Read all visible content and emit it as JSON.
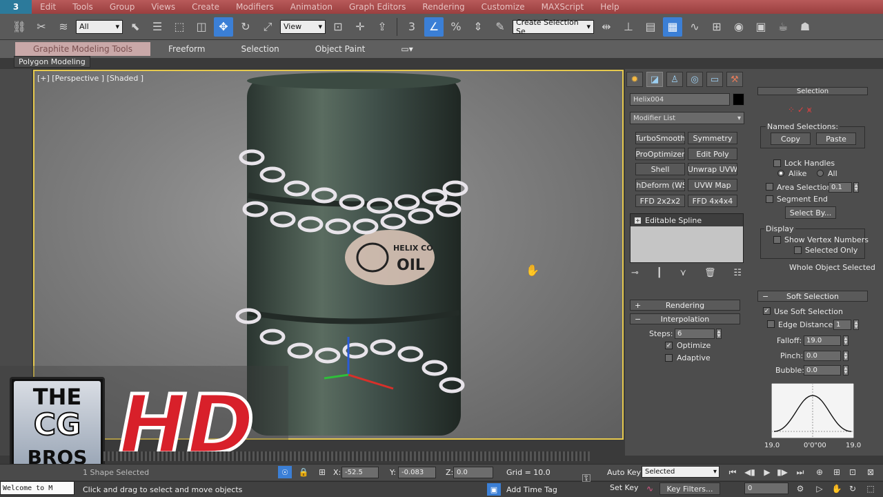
{
  "menu": {
    "logo": "3",
    "items": [
      "Edit",
      "Tools",
      "Group",
      "Views",
      "Create",
      "Modifiers",
      "Animation",
      "Graph Editors",
      "Rendering",
      "Customize",
      "MAXScript",
      "Help"
    ]
  },
  "toolbar": {
    "filter_value": "All",
    "view_value": "View",
    "snap_label": "3",
    "selection_set_value": "Create Selection Se"
  },
  "ribbon": {
    "tabs": [
      "Graphite Modeling Tools",
      "Freeform",
      "Selection",
      "Object Paint"
    ],
    "panel_label": "Polygon Modeling"
  },
  "viewport": {
    "label": "[+] [Perspective ] [Shaded ]",
    "barrel_text_top": "HELIX CO",
    "barrel_text_bottom": "OIL"
  },
  "watermark": {
    "line1": "THE",
    "line2": "CG",
    "line3": "BROS",
    "hd": "HD"
  },
  "command_panel": {
    "object_name": "Helix004",
    "modifier_list": "Modifier List",
    "modifier_buttons": [
      "TurboSmooth",
      "Symmetry",
      "ProOptimizer",
      "Edit Poly",
      "Shell",
      "Unwrap UVW",
      "thDeform (WS",
      "UVW Map",
      "FFD 2x2x2",
      "FFD 4x4x4"
    ],
    "stack_item": "Editable Spline",
    "rendering": "Rendering",
    "interpolation": "Interpolation",
    "steps_label": "Steps:",
    "steps_value": "6",
    "optimize": "Optimize",
    "adaptive": "Adaptive"
  },
  "selection_rollout": {
    "title": "Selection",
    "named_selections": "Named Selections:",
    "copy": "Copy",
    "paste": "Paste",
    "lock_handles": "Lock Handles",
    "alike": "Alike",
    "all": "All",
    "area_selection": "Area Selection:",
    "area_value": "0.1",
    "segment_end": "Segment End",
    "select_by": "Select By...",
    "display": "Display",
    "show_vertex_numbers": "Show Vertex Numbers",
    "selected_only": "Selected Only",
    "whole_object": "Whole Object Selected"
  },
  "soft_selection": {
    "title": "Soft Selection",
    "use_soft": "Use Soft Selection",
    "edge_distance": "Edge Distance:",
    "edge_value": "1",
    "falloff_label": "Falloff:",
    "falloff_value": "19.0",
    "pinch_label": "Pinch:",
    "pinch_value": "0.0",
    "bubble_label": "Bubble:",
    "bubble_value": "0.0",
    "curve_left": "19.0",
    "curve_mid": "0'0\"00",
    "curve_right": "19.0"
  },
  "status": {
    "maxscript": "Welcome to M",
    "selected_count": "1 Shape Selected",
    "prompt": "Click and drag to select and move objects",
    "x_label": "X:",
    "x_value": "-52.5",
    "y_label": "Y:",
    "y_value": "-0.083",
    "z_label": "Z:",
    "z_value": "0.0",
    "grid": "Grid = 10.0",
    "add_time_tag": "Add Time Tag",
    "auto_key": "Auto Key",
    "set_key": "Set Key",
    "key_mode": "Selected",
    "key_filters": "Key Filters...",
    "frame": "0"
  },
  "colors": {
    "menubar": "#b85a5a",
    "active_button": "#3b7fd6",
    "viewport_border": "#e6c94d",
    "hd_red": "#d8202a"
  }
}
